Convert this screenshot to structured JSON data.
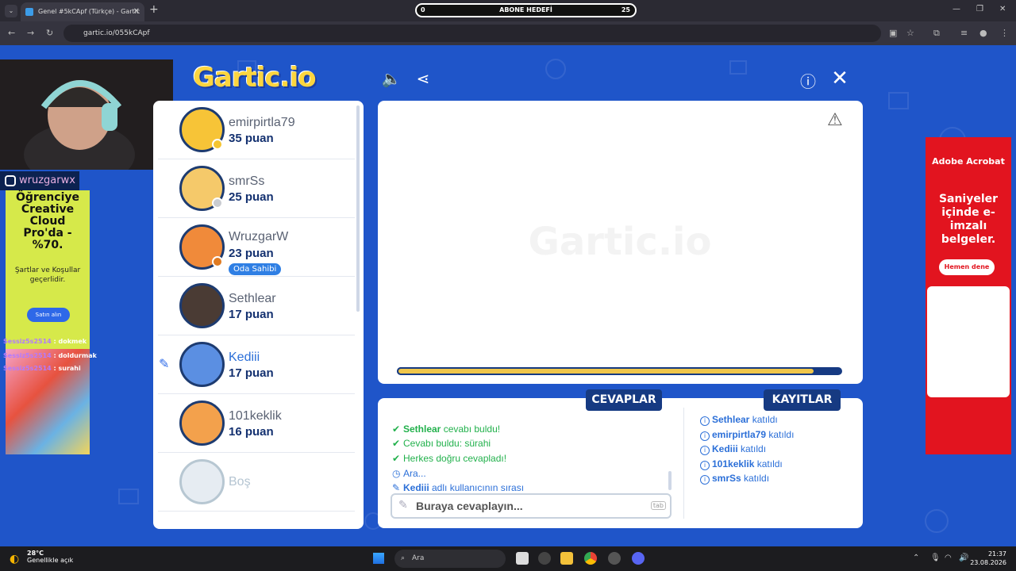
{
  "browser": {
    "tab_title": "Genel #5kCApf (Türkçe) - Gartic",
    "new_tab": "+",
    "close_tab": "✕",
    "url": "gartic.io/055kCApf",
    "subscriber_goal": {
      "label": "ABONE HEDEFİ",
      "current": "0",
      "target": "25"
    }
  },
  "stream_overlay": {
    "instagram_handle": "wruzgarwx",
    "chat": [
      {
        "user": "Sessiz5s2514",
        "message": "dokmek"
      },
      {
        "user": "Sessiz5s2514",
        "message": "doldurmak"
      },
      {
        "user": "Sessiz5s2514",
        "message": "surahi"
      }
    ]
  },
  "ad_left": {
    "headline": "Öğrenciye Creative Cloud Pro'da - %70.",
    "subtext": "Şartlar ve Koşullar geçerlidir.",
    "button": "Satın alın"
  },
  "ad_right": {
    "brand": "Adobe Acrobat",
    "headline": "Saniyeler içinde e-imzalı belgeler.",
    "button": "Hemen dene"
  },
  "game": {
    "logo": "Gartic.io",
    "canvas_watermark": "Gartic.io",
    "timer_fraction": 0.94,
    "players": [
      {
        "name": "emirpirtla79",
        "score": "35 puan",
        "dot_color": "#f5c531",
        "avatar_color": "#f7c437",
        "drawing": false,
        "owner": false
      },
      {
        "name": "smrSs",
        "score": "25 puan",
        "dot_color": "#c9ccd1",
        "avatar_color": "#f5c96a",
        "drawing": false,
        "owner": false
      },
      {
        "name": "WruzgarW",
        "score": "23 puan",
        "dot_color": "#e07b22",
        "avatar_color": "#f08a3a",
        "drawing": false,
        "owner": true,
        "owner_label": "Oda Sahibi"
      },
      {
        "name": "Sethlear",
        "score": "17 puan",
        "dot_color": "",
        "avatar_color": "#4a3b34",
        "drawing": false,
        "owner": false
      },
      {
        "name": "Kediii",
        "score": "17 puan",
        "dot_color": "",
        "avatar_color": "#5b8fe2",
        "drawing": true,
        "owner": false
      },
      {
        "name": "101keklik",
        "score": "16 puan",
        "dot_color": "",
        "avatar_color": "#f3a14c",
        "drawing": false,
        "owner": false
      },
      {
        "name": "Boş",
        "score": "",
        "dot_color": "",
        "avatar_color": "#e6ecf2",
        "drawing": false,
        "owner": false,
        "empty": true
      }
    ],
    "answers_tab": "CEVAPLAR",
    "logs_tab": "KAYITLAR",
    "answers": [
      {
        "user": "Sethlear",
        "text": " cevabı buldu!",
        "type": "correct"
      },
      {
        "user": "",
        "text": "Cevabı buldu: sürahi",
        "type": "correct"
      },
      {
        "user": "",
        "text": "Herkes doğru cevapladı!",
        "type": "correct"
      },
      {
        "user": "",
        "text": "Ara...",
        "type": "info"
      },
      {
        "user": "Kediii",
        "text": " adlı kullanıcının sırası",
        "type": "turn"
      }
    ],
    "answer_placeholder": "Buraya cevaplayın...",
    "answer_key_hint": "tab",
    "logs": [
      {
        "user": "Sethlear",
        "text": " katıldı"
      },
      {
        "user": "emirpirtla79",
        "text": " katıldı"
      },
      {
        "user": "Kediii",
        "text": " katıldı"
      },
      {
        "user": "101keklik",
        "text": " katıldı"
      },
      {
        "user": "smrSs",
        "text": " katıldı"
      }
    ]
  },
  "taskbar": {
    "temperature": "28°C",
    "weather": "Genellikle açık",
    "search": "Ara",
    "time": "21:37",
    "date": "23.08.2026"
  }
}
